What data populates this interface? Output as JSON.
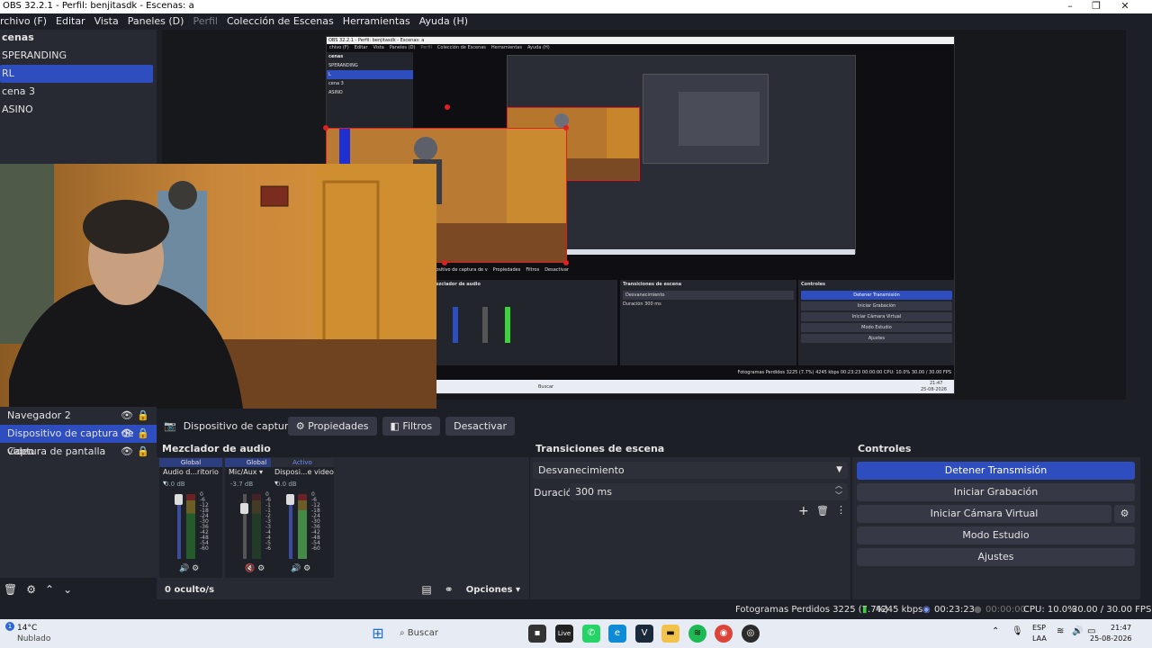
{
  "window": {
    "title": "OBS 32.2.1 - Perfil: benjitasdk - Escenas: a"
  },
  "menu": [
    "rchivo (F)",
    "Editar",
    "Vista",
    "Paneles (D)",
    "Perfil",
    "Colección de Escenas",
    "Herramientas",
    "Ayuda (H)"
  ],
  "scenes": {
    "title": "cenas",
    "items": [
      "SPERANDING",
      "RL",
      "cena 3",
      "ASINO"
    ],
    "selected_index": 1
  },
  "sources": {
    "items": [
      {
        "label": "Navegador 2",
        "selected": false
      },
      {
        "label": "Dispositivo de captura de video",
        "selected": true
      },
      {
        "label": "Captura de pantalla",
        "selected": false
      }
    ]
  },
  "source_toolbar": {
    "name": "Dispositivo de captura de v",
    "properties": "Propiedades",
    "filters": "Filtros",
    "deactivate": "Desactivar"
  },
  "mixer": {
    "title": "Mezclador de audio",
    "channels": [
      {
        "tag": "Global",
        "name": "Audio d...ritorio",
        "db": "0.0 dB",
        "level": 0.0,
        "muted": false
      },
      {
        "tag": "Global",
        "name": "Mic/Aux",
        "db": "-3.7 dB",
        "level": 0.0,
        "muted": true
      },
      {
        "tag": "Activo",
        "name": "Disposi...e video",
        "db": "0.0 dB",
        "level": 0.75,
        "muted": false
      }
    ],
    "scale": [
      "0",
      "-6",
      "-12",
      "-18",
      "-24",
      "-30",
      "-36",
      "-42",
      "-48",
      "-54",
      "-60"
    ],
    "hidden": "0 oculto/s",
    "options": "Opciones"
  },
  "transitions": {
    "title": "Transiciones de escena",
    "selected": "Desvanecimiento",
    "duration_label": "Duración",
    "duration_value": "300 ms"
  },
  "controls": {
    "title": "Controles",
    "buttons": [
      "Detener Transmisión",
      "Iniciar Grabación",
      "Iniciar Cámara Virtual",
      "Modo Estudio",
      "Ajustes"
    ]
  },
  "status": {
    "dropped": "Fotogramas Perdidos 3225 (7.7%)",
    "bitrate": "4245 kbps",
    "stream_time": "00:23:23",
    "rec_time": "00:00:00",
    "cpu": "CPU: 10.0%",
    "fps": "30.00 / 30.00 FPS"
  },
  "taskbar": {
    "weather_temp": "14°C",
    "weather_desc": "Nublado",
    "search": "Buscar",
    "lang1": "ESP",
    "lang2": "LAA",
    "time": "21:47",
    "date": "25-08-2026",
    "badge": "1"
  },
  "nested": {
    "title": "OBS 32.2.1 - Perfil: benjitasdk - Escenas: a",
    "menu": [
      "chivo (F)",
      "Editar",
      "Vista",
      "Paneles (D)",
      "Perfil",
      "Colección de Escenas",
      "Herramientas",
      "Ayuda (H)"
    ],
    "scenes_title": "cenas",
    "scenes": [
      "SPERANDING",
      "L",
      "cena 3",
      "ASINO"
    ],
    "src_name": "positivo de captura de v",
    "properties": "Propiedades",
    "filters": "Filtros",
    "deactivate": "Desactivar",
    "mixer_title": "ezclador de audio",
    "transitions_title": "Transiciones de escena",
    "transition": "Desvanecimiento",
    "duration_label": "Duración",
    "duration": "300 ms",
    "controls_title": "Controles",
    "buttons": [
      "Detener Transmisión",
      "Iniciar Grabación",
      "Iniciar Cámara Virtual",
      "Modo Estudio",
      "Ajustes"
    ],
    "status": "Fotogramas Perdidos 3225 (7.7%)   4245 kbps   00:23:23   00:00:00   CPU: 10.0%   30.00 / 30.00 FPS",
    "search": "Buscar",
    "time": "21:47",
    "date": "25-08-2026"
  }
}
